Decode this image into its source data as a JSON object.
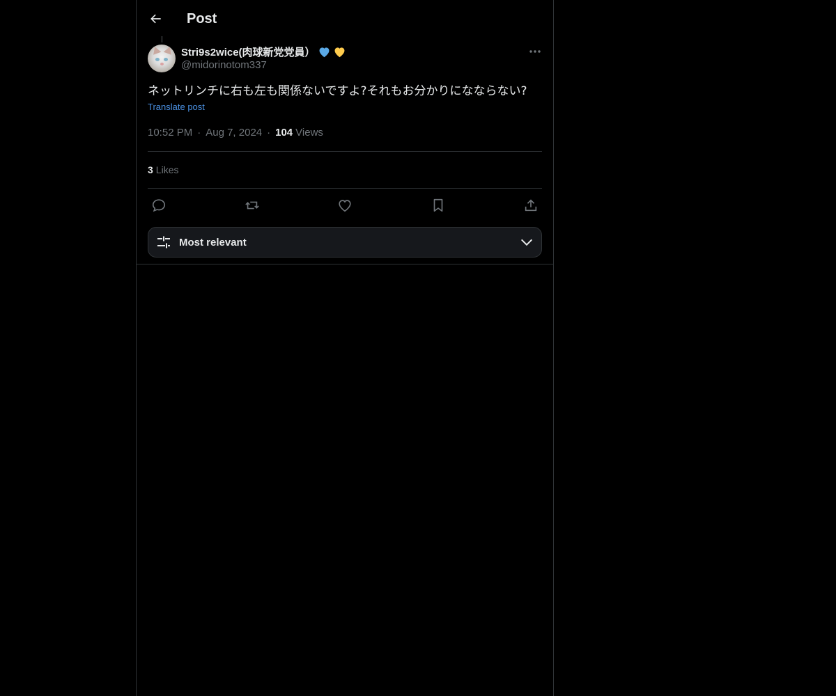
{
  "header": {
    "title": "Post"
  },
  "post": {
    "display_name": "Stri9s2wice(肉球新党党員）",
    "handle": "@midorinotom337",
    "text": "ネットリンチに右も左も関係ないですよ?それもお分かりになならない?",
    "translate_label": "Translate post",
    "time": "10:52 PM",
    "date": "Aug 7, 2024",
    "views_count": "104",
    "views_label": "Views",
    "likes_count": "3",
    "likes_label": "Likes"
  },
  "sort": {
    "label": "Most relevant"
  },
  "colors": {
    "background": "#000000",
    "text": "#e7e9ea",
    "muted": "#71767b",
    "link": "#4a90e2",
    "border": "#2f3336"
  },
  "icons": [
    "back-arrow-icon",
    "blue-heart-icon",
    "yellow-heart-icon",
    "more-icon",
    "reply-icon",
    "repost-icon",
    "like-icon",
    "bookmark-icon",
    "share-icon",
    "sliders-icon",
    "chevron-down-icon"
  ]
}
